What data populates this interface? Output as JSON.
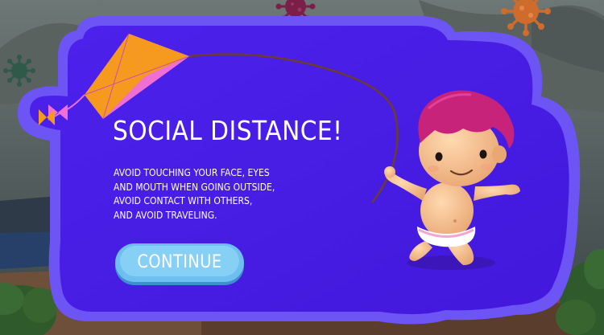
{
  "dialog": {
    "title": "SOCIAL DISTANCE!",
    "message_lines": [
      "AVOID TOUCHING YOUR FACE, EYES",
      "AND MOUTH WHEN GOING OUTSIDE,",
      "AVOID CONTACT WITH OTHERS,",
      "AND AVOID TRAVELING."
    ],
    "continue_label": "CONTINUE"
  },
  "icons": {
    "virus": "virus-icon",
    "kite": "kite-icon",
    "character": "kid-character"
  },
  "colors": {
    "panel": "#4a1fe6",
    "panel_border": "#6d56f5",
    "button": "#6fbef0",
    "kite_pink": "#f06fd4",
    "kite_orange": "#f59a1e",
    "virus_red": "#7a1f48",
    "virus_orange": "#cf6b2b",
    "virus_green": "#2f5948"
  }
}
